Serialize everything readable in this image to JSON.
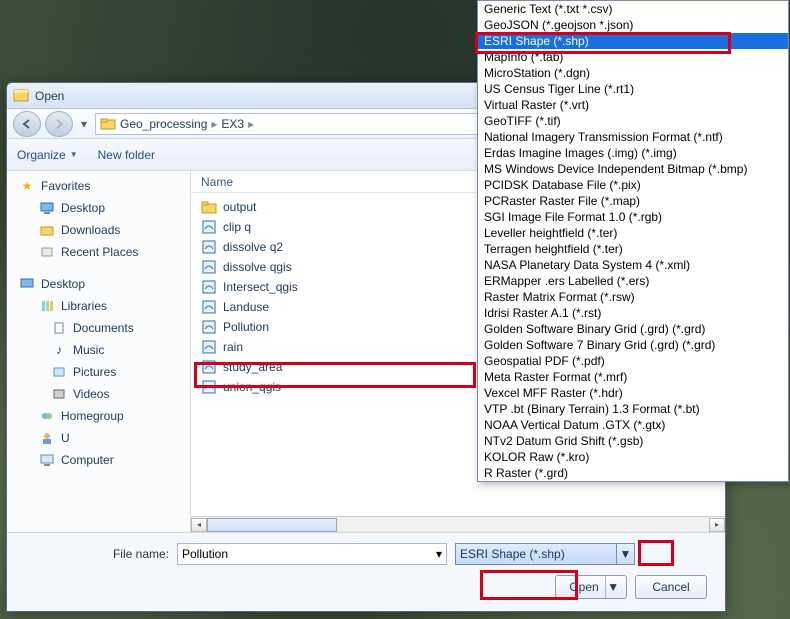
{
  "window": {
    "title": "Open"
  },
  "breadcrumb": {
    "parts": [
      "Geo_processing",
      "EX3"
    ]
  },
  "toolbar": {
    "organize": "Organize",
    "new_folder": "New folder"
  },
  "tree": {
    "favorites": "Favorites",
    "desktop": "Desktop",
    "downloads": "Downloads",
    "recent_places": "Recent Places",
    "desktop2": "Desktop",
    "libraries": "Libraries",
    "documents": "Documents",
    "music": "Music",
    "pictures": "Pictures",
    "videos": "Videos",
    "homegroup": "Homegroup",
    "u": "U",
    "computer": "Computer"
  },
  "filelist": {
    "header_name": "Name",
    "items": [
      {
        "label": "output",
        "type": "folder"
      },
      {
        "label": "clip q",
        "type": "shp"
      },
      {
        "label": "dissolve q2",
        "type": "shp"
      },
      {
        "label": "dissolve qgis",
        "type": "shp"
      },
      {
        "label": "Intersect_qgis",
        "type": "shp"
      },
      {
        "label": "Landuse",
        "type": "shp"
      },
      {
        "label": "Pollution",
        "type": "shp"
      },
      {
        "label": "rain",
        "type": "shp"
      },
      {
        "label": "study_area",
        "type": "shp"
      },
      {
        "label": "union_qgis",
        "type": "shp"
      }
    ]
  },
  "filetypes": {
    "items": [
      "Generic Text (*.txt *.csv)",
      "GeoJSON (*.geojson *.json)",
      "ESRI Shape (*.shp)",
      "MapInfo (*.tab)",
      "MicroStation (*.dgn)",
      "US Census Tiger Line (*.rt1)",
      "Virtual Raster (*.vrt)",
      "GeoTIFF (*.tif)",
      "National Imagery Transmission Format (*.ntf)",
      "Erdas Imagine Images (.img) (*.img)",
      "MS Windows Device Independent Bitmap (*.bmp)",
      "PCIDSK Database File (*.pix)",
      "PCRaster Raster File (*.map)",
      "SGI Image File Format 1.0 (*.rgb)",
      "Leveller heightfield (*.ter)",
      "Terragen heightfield (*.ter)",
      "NASA Planetary Data System 4 (*.xml)",
      "ERMapper .ers Labelled (*.ers)",
      "Raster Matrix Format (*.rsw)",
      "Idrisi Raster A.1 (*.rst)",
      "Golden Software Binary Grid (.grd) (*.grd)",
      "Golden Software 7 Binary Grid (.grd) (*.grd)",
      "Geospatial PDF (*.pdf)",
      "Meta Raster Format (*.mrf)",
      "Vexcel MFF Raster (*.hdr)",
      "VTP .bt (Binary Terrain) 1.3 Format (*.bt)",
      "NOAA Vertical Datum .GTX (*.gtx)",
      "NTv2 Datum Grid Shift (*.gsb)",
      "KOLOR Raw (*.kro)",
      "R Raster (*.grd)"
    ],
    "selected_index": 2
  },
  "bottom": {
    "filename_label": "File name:",
    "filename_value": "Pollution",
    "filetype_value": "ESRI Shape (*.shp)",
    "open": "Open",
    "cancel": "Cancel"
  }
}
